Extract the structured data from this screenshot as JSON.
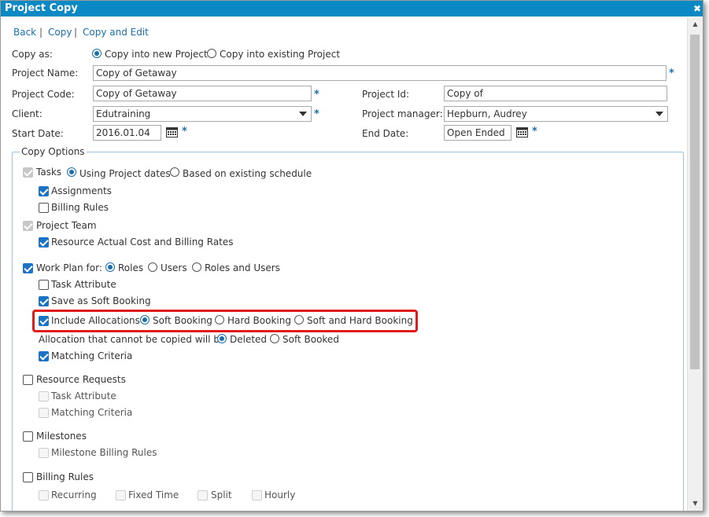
{
  "title": "Project Copy",
  "close_glyph": "✖",
  "nav": {
    "back": "Back",
    "copy": "Copy",
    "copy_edit": "Copy and Edit",
    "sep": "|"
  },
  "copy_as": {
    "label": "Copy as:",
    "opt_new": "Copy into new Project",
    "opt_existing": "Copy into existing Project",
    "selected": "new"
  },
  "project_name": {
    "label": "Project Name:",
    "value": "Copy of Getaway"
  },
  "project_code": {
    "label": "Project Code:",
    "value": "Copy of Getaway"
  },
  "project_id": {
    "label": "Project Id:",
    "value": "Copy of"
  },
  "client": {
    "label": "Client:",
    "value": "Edutraining"
  },
  "project_manager": {
    "label": "Project manager:",
    "value": "Hepburn, Audrey"
  },
  "start_date": {
    "label": "Start Date:",
    "value": "2016.01.04"
  },
  "end_date": {
    "label": "End Date:",
    "value": "Open Ended"
  },
  "required_mark": "*",
  "copy_options": {
    "legend": "Copy Options",
    "tasks": {
      "label": "Tasks",
      "checked": true,
      "disabled": true,
      "opt_project_dates": "Using Project dates",
      "opt_existing_schedule": "Based on existing schedule"
    },
    "assignments": {
      "label": "Assignments",
      "checked": true
    },
    "billing_rules_tasks": {
      "label": "Billing Rules",
      "checked": false
    },
    "project_team": {
      "label": "Project Team",
      "checked": true,
      "disabled": true
    },
    "resource_actual_cost": {
      "label": "Resource Actual Cost and Billing Rates",
      "checked": true
    },
    "work_plan": {
      "label": "Work Plan for:",
      "checked": true,
      "opt_roles": "Roles",
      "opt_users": "Users",
      "opt_roles_users": "Roles and Users"
    },
    "task_attribute_wp": {
      "label": "Task Attribute",
      "checked": false
    },
    "save_soft_booking": {
      "label": "Save as Soft Booking",
      "checked": true
    },
    "include_allocations": {
      "label": "Include Allocations",
      "checked": true,
      "opt_soft": "Soft Booking",
      "opt_hard": "Hard Booking",
      "opt_soft_hard": "Soft and Hard Booking"
    },
    "allocation_note": {
      "label": "Allocation that cannot be copied will be",
      "opt_deleted": "Deleted",
      "opt_soft_booked": "Soft Booked"
    },
    "matching_criteria_wp": {
      "label": "Matching Criteria",
      "checked": true
    },
    "resource_requests": {
      "label": "Resource Requests",
      "checked": false
    },
    "task_attribute_rr": {
      "label": "Task Attribute"
    },
    "matching_criteria_rr": {
      "label": "Matching Criteria"
    },
    "milestones": {
      "label": "Milestones",
      "checked": false
    },
    "milestone_billing_rules": {
      "label": "Milestone Billing Rules"
    },
    "billing_rules": {
      "label": "Billing Rules",
      "checked": false
    },
    "recurring": {
      "label": "Recurring"
    },
    "fixed_time": {
      "label": "Fixed Time"
    },
    "split": {
      "label": "Split"
    },
    "hourly": {
      "label": "Hourly"
    }
  },
  "colors": {
    "title_bar": "#0b89c4",
    "link": "#1a6fae",
    "highlight": "#e01b1b",
    "checkbox": "#1a73c4"
  }
}
